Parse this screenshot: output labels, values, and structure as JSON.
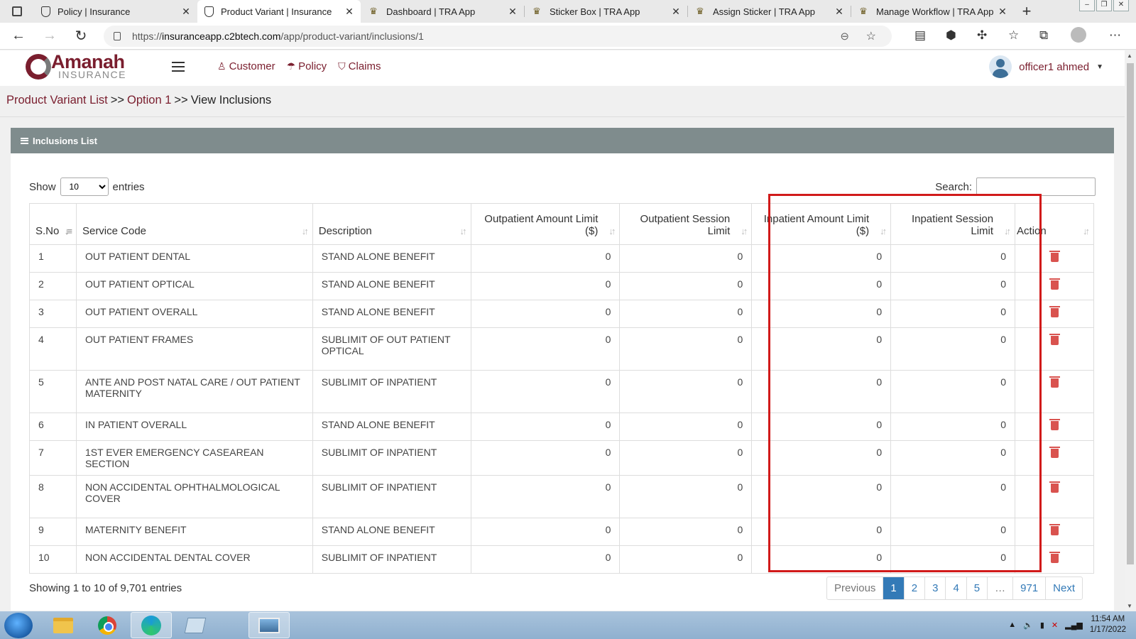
{
  "browser": {
    "tabs": [
      {
        "title": "Policy | Insurance",
        "icon": "shield-icon"
      },
      {
        "title": "Product Variant | Insurance",
        "icon": "shield-icon",
        "active": true
      },
      {
        "title": "Dashboard | TRA App",
        "icon": "emblem-icon"
      },
      {
        "title": "Sticker Box | TRA App",
        "icon": "emblem-icon"
      },
      {
        "title": "Assign Sticker | TRA App",
        "icon": "emblem-icon"
      },
      {
        "title": "Manage Workflow | TRA App",
        "icon": "emblem-icon"
      }
    ],
    "url_prefix": "https://",
    "url_host": "insuranceapp.c2btech.com",
    "url_path": "/app/product-variant/inclusions/1"
  },
  "app": {
    "logo_text": "Amanah",
    "logo_sub": "INSURANCE",
    "nav": [
      {
        "label": "Customer",
        "icon": "user-icon"
      },
      {
        "label": "Policy",
        "icon": "umbrella-icon"
      },
      {
        "label": "Claims",
        "icon": "shield-icon"
      }
    ],
    "user_name": "officer1 ahmed"
  },
  "breadcrumb": {
    "item1": "Product Variant List",
    "sep1": ">>",
    "item2": "Option 1",
    "sep2": ">>",
    "item3": "View Inclusions"
  },
  "panel": {
    "title": "Inclusions List",
    "show_label": "Show",
    "entries_label": "entries",
    "page_size": "10",
    "search_label": "Search:"
  },
  "table": {
    "headers": {
      "sno": "S.No",
      "service_code": "Service Code",
      "description": "Description",
      "op_amount_1": "Outpatient Amount Limit",
      "op_amount_2": "($)",
      "op_session_1": "Outpatient Session",
      "op_session_2": "Limit",
      "ip_amount_1": "Inpatient Amount Limit",
      "ip_amount_2": "($)",
      "ip_session_1": "Inpatient Session",
      "ip_session_2": "Limit",
      "action": "Action"
    },
    "rows": [
      {
        "sno": "1",
        "service_code": "OUT PATIENT DENTAL",
        "description": "STAND ALONE BENEFIT",
        "op_amount": "0",
        "op_session": "0",
        "ip_amount": "0",
        "ip_session": "0"
      },
      {
        "sno": "2",
        "service_code": "OUT PATIENT OPTICAL",
        "description": "STAND ALONE BENEFIT",
        "op_amount": "0",
        "op_session": "0",
        "ip_amount": "0",
        "ip_session": "0"
      },
      {
        "sno": "3",
        "service_code": "OUT PATIENT OVERALL",
        "description": "STAND ALONE BENEFIT",
        "op_amount": "0",
        "op_session": "0",
        "ip_amount": "0",
        "ip_session": "0"
      },
      {
        "sno": "4",
        "service_code": "OUT PATIENT FRAMES",
        "description": "SUBLIMIT OF OUT PATIENT OPTICAL",
        "op_amount": "0",
        "op_session": "0",
        "ip_amount": "0",
        "ip_session": "0"
      },
      {
        "sno": "5",
        "service_code": "ANTE AND POST NATAL CARE / OUT PATIENT MATERNITY",
        "description": "SUBLIMIT OF INPATIENT",
        "op_amount": "0",
        "op_session": "0",
        "ip_amount": "0",
        "ip_session": "0"
      },
      {
        "sno": "6",
        "service_code": "IN PATIENT OVERALL",
        "description": "STAND ALONE BENEFIT",
        "op_amount": "0",
        "op_session": "0",
        "ip_amount": "0",
        "ip_session": "0"
      },
      {
        "sno": "7",
        "service_code": "1ST EVER EMERGENCY CASEAREAN SECTION",
        "description": "SUBLIMIT OF INPATIENT",
        "op_amount": "0",
        "op_session": "0",
        "ip_amount": "0",
        "ip_session": "0"
      },
      {
        "sno": "8",
        "service_code": "NON ACCIDENTAL OPHTHALMOLOGICAL COVER",
        "description": "SUBLIMIT OF INPATIENT",
        "op_amount": "0",
        "op_session": "0",
        "ip_amount": "0",
        "ip_session": "0"
      },
      {
        "sno": "9",
        "service_code": "MATERNITY BENEFIT",
        "description": "STAND ALONE BENEFIT",
        "op_amount": "0",
        "op_session": "0",
        "ip_amount": "0",
        "ip_session": "0"
      },
      {
        "sno": "10",
        "service_code": "NON ACCIDENTAL DENTAL COVER",
        "description": "SUBLIMIT OF INPATIENT",
        "op_amount": "0",
        "op_session": "0",
        "ip_amount": "0",
        "ip_session": "0"
      }
    ]
  },
  "footer": {
    "info": "Showing 1 to 10 of 9,701 entries",
    "pagination": {
      "previous": "Previous",
      "p1": "1",
      "p2": "2",
      "p3": "3",
      "p4": "4",
      "p5": "5",
      "ellipsis": "…",
      "last": "971",
      "next": "Next"
    }
  },
  "taskbar": {
    "time": "11:54 AM",
    "date": "1/17/2022"
  },
  "colors": {
    "brand": "#7a1e2e",
    "panel_header": "#7f8c8d",
    "highlight": "#d11a1a",
    "link": "#337ab7",
    "delete": "#d9534f"
  }
}
